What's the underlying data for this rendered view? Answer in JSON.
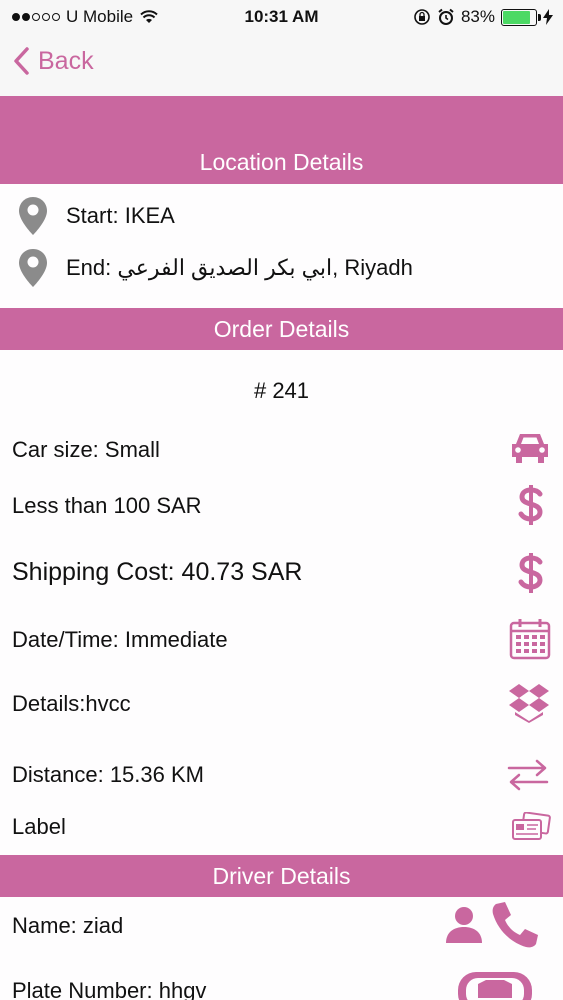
{
  "status_bar": {
    "carrier": "U Mobile",
    "time": "10:31 AM",
    "battery": "83%",
    "battery_level": 0.83
  },
  "nav": {
    "back_label": "Back"
  },
  "location": {
    "header": "Location Details",
    "start_label": "Start:",
    "start_value": "IKEA",
    "end_label": "End:",
    "end_value": "ابي بكر الصديق الفرعي, Riyadh"
  },
  "order": {
    "header": "Order Details",
    "number": "# 241",
    "car_size": "Car size: Small",
    "price_range": "Less than 100 SAR",
    "shipping_cost": "Shipping Cost: 40.73  SAR",
    "datetime": "Date/Time: Immediate",
    "details": "Details:hvcc",
    "distance": "Distance: 15.36  KM",
    "label": "Label"
  },
  "driver": {
    "header": "Driver Details",
    "name": "Name: ziad",
    "plate": "Plate Number: hhgv"
  },
  "colors": {
    "accent": "#c9679f",
    "battery": "#4cd964"
  }
}
